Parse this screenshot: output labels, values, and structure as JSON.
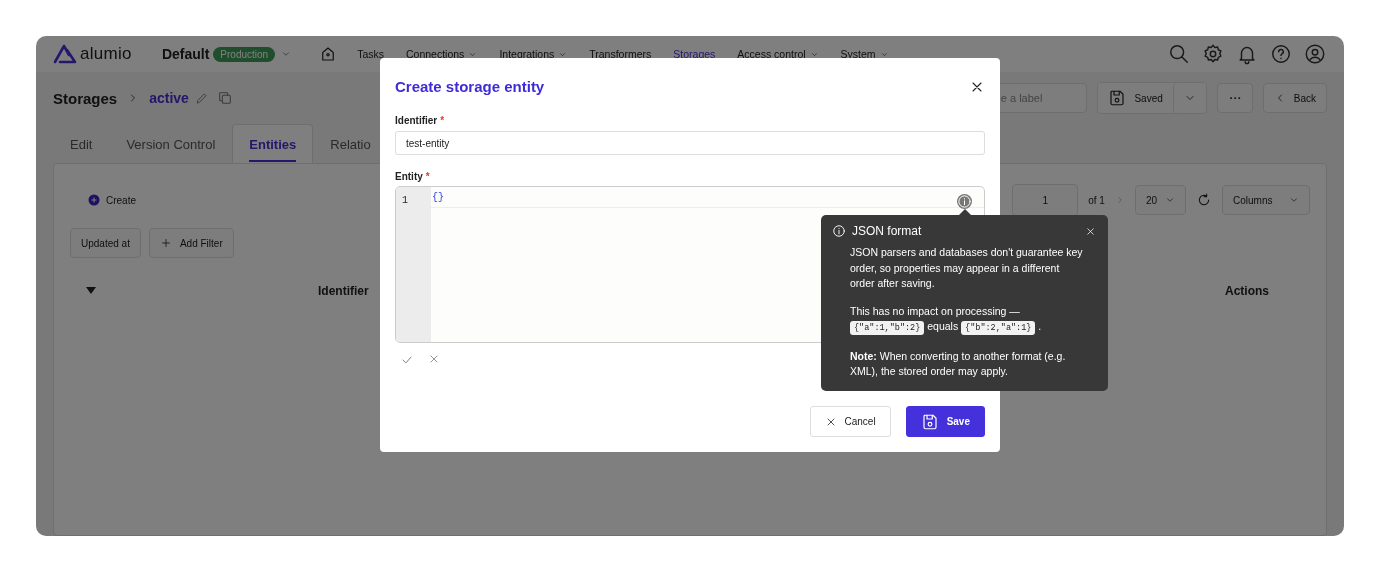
{
  "header": {
    "brand": "alumio",
    "workspace": "Default",
    "environment": "Production",
    "nav": [
      {
        "label": "Tasks",
        "selected": false,
        "dropdown": false
      },
      {
        "label": "Connections",
        "selected": false,
        "dropdown": true
      },
      {
        "label": "Integrations",
        "selected": false,
        "dropdown": true
      },
      {
        "label": "Transformers",
        "selected": false,
        "dropdown": false
      },
      {
        "label": "Storages",
        "selected": true,
        "dropdown": false
      },
      {
        "label": "Access control",
        "selected": false,
        "dropdown": true
      },
      {
        "label": "System",
        "selected": false,
        "dropdown": true
      }
    ]
  },
  "page": {
    "breadcrumb": "Storages",
    "current": "active",
    "label_placeholder": "e a label",
    "save_status": "Saved",
    "back": "Back"
  },
  "tabs": [
    {
      "label": "Edit",
      "selected": false
    },
    {
      "label": "Version Control",
      "selected": false
    },
    {
      "label": "Entities",
      "selected": true
    },
    {
      "label": "Relatio",
      "selected": false
    }
  ],
  "toolbar": {
    "create": "Create",
    "filters": [
      "Updated at"
    ],
    "add_filter": "Add Filter",
    "page": "1",
    "page_of": "of 1",
    "page_size": "20",
    "columns": "Columns"
  },
  "table": {
    "columns": [
      "Identifier",
      "Actions"
    ]
  },
  "modal": {
    "title": "Create storage entity",
    "fields": [
      {
        "kind": "text",
        "label": "Identifier",
        "required_mark": "*",
        "value": "test-entity"
      },
      {
        "kind": "code",
        "label": "Entity",
        "required_mark": "*",
        "lines": [
          {
            "number": "1",
            "code": "{}"
          }
        ]
      }
    ],
    "buttons": [
      {
        "kind": "secondary",
        "label": "Cancel"
      },
      {
        "kind": "primary",
        "label": "Save"
      }
    ]
  },
  "tooltip": {
    "title": "JSON format",
    "paragraphs": [
      [
        {
          "kind": "text",
          "text": "JSON parsers and databases don't guarantee key order, so properties may appear in a different order after saving."
        }
      ],
      [
        {
          "kind": "text",
          "text": "This has no impact on processing —"
        },
        {
          "kind": "code",
          "text": "{\"a\":1,\"b\":2}"
        },
        {
          "kind": "text",
          "text": "equals"
        },
        {
          "kind": "code",
          "text": "{\"b\":2,\"a\":1}"
        },
        {
          "kind": "text",
          "text": "."
        }
      ],
      [
        {
          "kind": "rich",
          "text": "**Note:** When converting to another format (e.g. XML), the stored order may apply."
        }
      ]
    ]
  }
}
